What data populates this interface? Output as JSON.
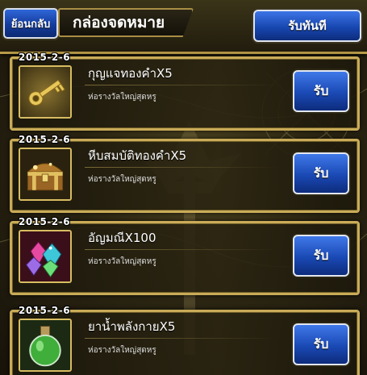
{
  "header": {
    "back_label": "ย้อนกลับ",
    "title": "กล่องจดหมาย",
    "claim_all_label": "รับทันที"
  },
  "mail": [
    {
      "date": "2015-2-6",
      "item": "กุญแจทองคำX5",
      "subtitle": "ห่อรางวัลใหญ่สุดหรู",
      "button": "รับ",
      "icon": "gold-key-icon"
    },
    {
      "date": "2015-2-6",
      "item": "หีบสมบัติทองคำX5",
      "subtitle": "ห่อรางวัลใหญ่สุดหรู",
      "button": "รับ",
      "icon": "treasure-chest-icon"
    },
    {
      "date": "2015-2-6",
      "item": "อัญมณีX100",
      "subtitle": "ห่อรางวัลใหญ่สุดหรู",
      "button": "รับ",
      "icon": "gems-icon"
    },
    {
      "date": "2015-2-6",
      "item": "ยาน้ำพลังกายX5",
      "subtitle": "ห่อรางวัลใหญ่สุดหรู",
      "button": "รับ",
      "icon": "stamina-potion-icon"
    }
  ]
}
